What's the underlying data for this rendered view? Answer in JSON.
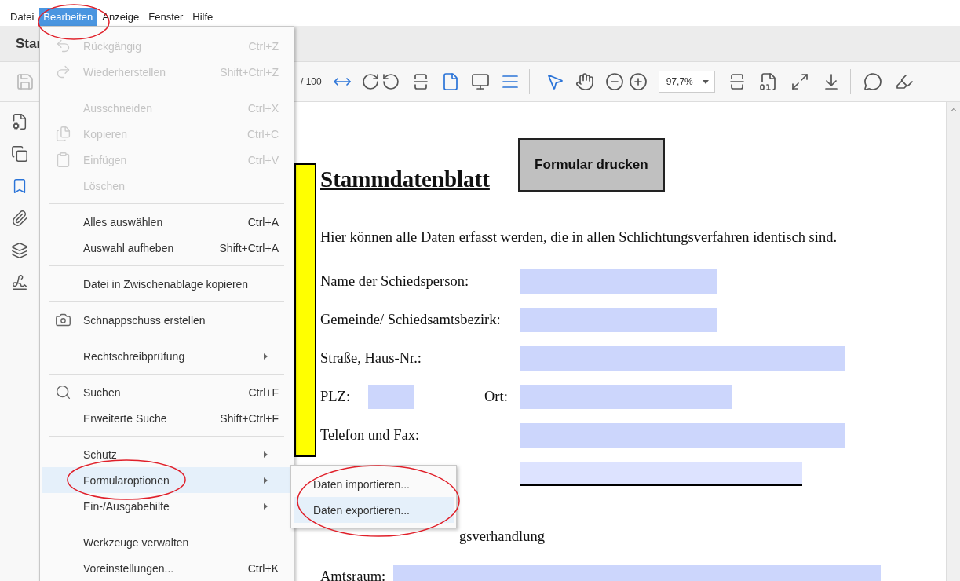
{
  "menubar": [
    {
      "label": "Datei",
      "selected": false
    },
    {
      "label": "Bearbeiten",
      "selected": true
    },
    {
      "label": "Anzeige",
      "selected": false
    },
    {
      "label": "Fenster",
      "selected": false
    },
    {
      "label": "Hilfe",
      "selected": false
    }
  ],
  "tabs": [
    {
      "label": "Star"
    }
  ],
  "toolbar": {
    "page_total": "/ 100",
    "zoom": "97,7%"
  },
  "edit_menu": [
    {
      "kind": "item",
      "label": "Rückgängig",
      "shortcut": "Ctrl+Z",
      "disabled": true,
      "selected": false
    },
    {
      "kind": "item",
      "label": "Wiederherstellen",
      "shortcut": "Shift+Ctrl+Z",
      "disabled": true,
      "selected": false
    },
    {
      "kind": "separator"
    },
    {
      "kind": "item",
      "label": "Ausschneiden",
      "shortcut": "Ctrl+X",
      "disabled": true,
      "selected": false
    },
    {
      "kind": "item",
      "label": "Kopieren",
      "shortcut": "Ctrl+C",
      "disabled": true,
      "selected": false
    },
    {
      "kind": "item",
      "label": "Einfügen",
      "shortcut": "Ctrl+V",
      "disabled": true,
      "selected": false
    },
    {
      "kind": "item",
      "label": "Löschen",
      "disabled": true,
      "selected": false
    },
    {
      "kind": "separator"
    },
    {
      "kind": "item",
      "label": "Alles auswählen",
      "shortcut": "Ctrl+A",
      "disabled": false,
      "selected": false
    },
    {
      "kind": "item",
      "label": "Auswahl aufheben",
      "shortcut": "Shift+Ctrl+A",
      "disabled": false,
      "selected": false
    },
    {
      "kind": "separator"
    },
    {
      "kind": "item",
      "label": "Datei in Zwischenablage kopieren",
      "disabled": false,
      "selected": false
    },
    {
      "kind": "separator"
    },
    {
      "kind": "item",
      "label": "Schnappschuss erstellen",
      "disabled": false,
      "selected": false
    },
    {
      "kind": "separator"
    },
    {
      "kind": "submenu",
      "label": "Rechtschreibprüfung",
      "disabled": false,
      "selected": false
    },
    {
      "kind": "separator"
    },
    {
      "kind": "item",
      "label": "Suchen",
      "shortcut": "Ctrl+F",
      "disabled": false,
      "selected": false
    },
    {
      "kind": "item",
      "label": "Erweiterte Suche",
      "shortcut": "Shift+Ctrl+F",
      "disabled": false,
      "selected": false
    },
    {
      "kind": "separator"
    },
    {
      "kind": "submenu",
      "label": "Schutz",
      "disabled": false,
      "selected": false
    },
    {
      "kind": "submenu",
      "label": "Formularoptionen",
      "disabled": false,
      "selected": true
    },
    {
      "kind": "submenu",
      "label": "Ein-/Ausgabehilfe",
      "disabled": false,
      "selected": false
    },
    {
      "kind": "separator"
    },
    {
      "kind": "item",
      "label": "Werkzeuge verwalten",
      "disabled": false,
      "selected": false
    },
    {
      "kind": "item",
      "label": "Voreinstellungen...",
      "shortcut": "Ctrl+K",
      "disabled": false,
      "selected": false
    }
  ],
  "submenu": [
    {
      "label": "Daten importieren...",
      "selected": false
    },
    {
      "label": "Daten exportieren...",
      "selected": true
    }
  ],
  "document": {
    "title": "Stammdatenblatt",
    "print_button": "Formular drucken",
    "intro": "Hier können alle Daten erfasst werden, die in allen Schlichtungsverfahren identisch sind.",
    "rows": [
      {
        "kind": "single",
        "label": "Name der Schiedsperson:"
      },
      {
        "kind": "single",
        "label": "Gemeinde/ Schiedsamtsbezirk:"
      },
      {
        "kind": "single",
        "label": "Straße, Haus-Nr.:"
      },
      {
        "kind": "pair",
        "label": "PLZ:",
        "label2": "Ort:"
      },
      {
        "kind": "single",
        "label": "Telefon und Fax:"
      },
      {
        "kind": "underlined"
      }
    ],
    "section_heading": "gsverhandlung",
    "room": {
      "label": "Amtsraum:"
    }
  }
}
